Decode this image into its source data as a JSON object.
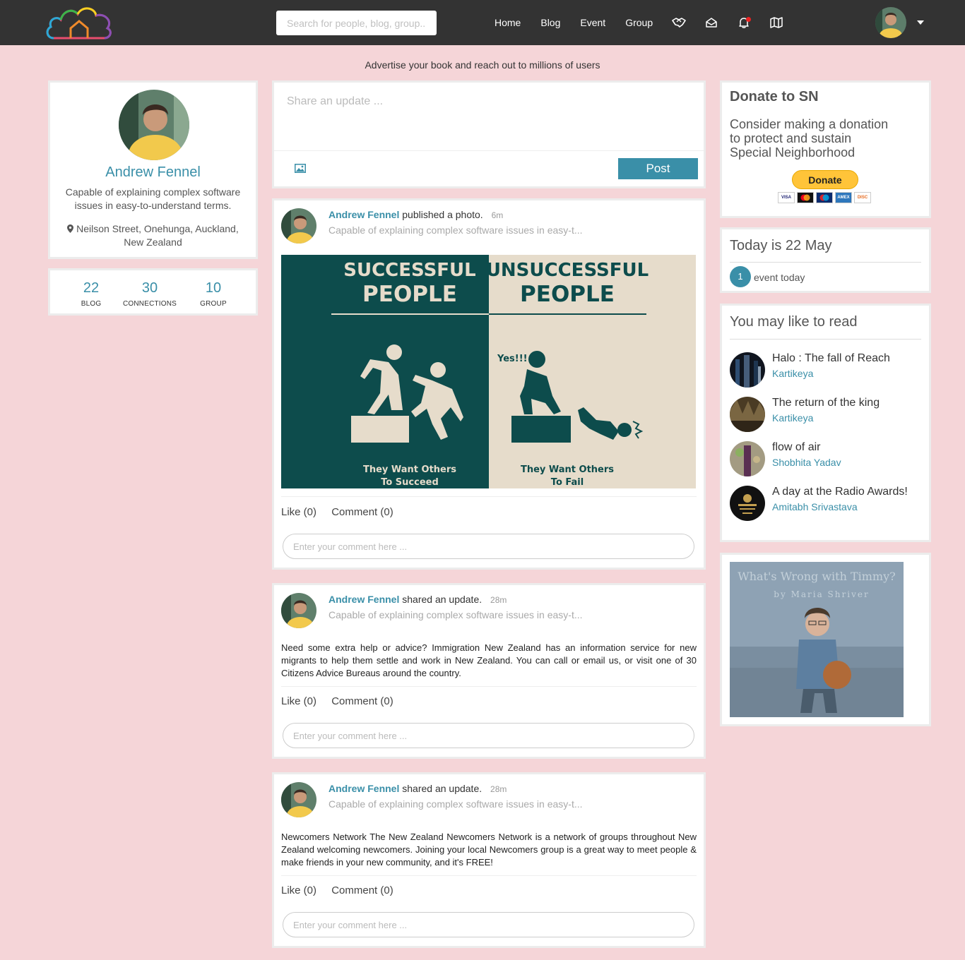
{
  "nav": {
    "search_placeholder": "Search for people, blog, group..",
    "links": [
      "Home",
      "Blog",
      "Event",
      "Group"
    ]
  },
  "ad": {
    "text": "Advertise your book and reach out to millions of users"
  },
  "profile": {
    "name": "Andrew Fennel",
    "bio": "Capable of explaining complex software issues in easy-to-understand terms.",
    "location": "Neilson Street, Onehunga, Auckland, New Zealand",
    "stats": [
      {
        "value": "22",
        "label": "BLOG"
      },
      {
        "value": "30",
        "label": "CONNECTIONS"
      },
      {
        "value": "10",
        "label": "GROUP"
      }
    ]
  },
  "share": {
    "placeholder": "Share an update ...",
    "post_label": "Post"
  },
  "posts": [
    {
      "author": "Andrew Fennel",
      "action": "published a photo.",
      "time": "6m",
      "subtitle": "Capable of explaining complex software issues in easy-t...",
      "image": {
        "left_title_1": "SUCCESSFUL",
        "left_title_2": "PEOPLE",
        "right_title_1": "UNSUCCESSFUL",
        "right_title_2": "PEOPLE",
        "yes": "Yes!!!",
        "left_caption_1": "They Want Others",
        "left_caption_2": "To Succeed",
        "right_caption_1": "They Want Others",
        "right_caption_2": "To Fail"
      },
      "like": "Like (0)",
      "comment": "Comment (0)",
      "comment_placeholder": "Enter your comment here ..."
    },
    {
      "author": "Andrew Fennel",
      "action": "shared an update.",
      "time": "28m",
      "subtitle": "Capable of explaining complex software issues in easy-t...",
      "text": "Need some extra help or advice? Immigration New Zealand has an information service for new migrants to help them settle and work in New Zealand. You can call or email us, or visit one of 30 Citizens Advice Bureaus around the country.",
      "like": "Like (0)",
      "comment": "Comment (0)",
      "comment_placeholder": "Enter your comment here ..."
    },
    {
      "author": "Andrew Fennel",
      "action": "shared an update.",
      "time": "28m",
      "subtitle": "Capable of explaining complex software issues in easy-t...",
      "text": "Newcomers Network The New Zealand Newcomers Network is a network of groups throughout New Zealand welcoming newcomers. Joining your local Newcomers group is a great way to meet people & make friends in your new community, and it's FREE!",
      "like": "Like (0)",
      "comment": "Comment (0)",
      "comment_placeholder": "Enter your comment here ..."
    }
  ],
  "donate": {
    "title": "Donate to SN",
    "text_1": "Consider making a donation",
    "text_2": "to protect and sustain",
    "text_3": "Special Neighborhood",
    "button": "Donate"
  },
  "today": {
    "title": "Today is 22 May",
    "count": "1",
    "label": "event today"
  },
  "reads": {
    "title": "You may like to read",
    "items": [
      {
        "title": "Halo : The fall of Reach",
        "author": "Kartikeya"
      },
      {
        "title": "The return of the king",
        "author": "Kartikeya"
      },
      {
        "title": "flow of air",
        "author": "Shobhita Yadav"
      },
      {
        "title": "A day at the Radio Awards!",
        "author": "Amitabh Srivastava"
      }
    ]
  },
  "book_ad": {
    "title": "What's Wrong with Timmy?",
    "author": "by Maria Shriver"
  },
  "colors": {
    "accent": "#3a8fa8",
    "nav": "#333333",
    "background": "#f5d5d8",
    "poster_dark": "#0d4c4c",
    "poster_light": "#e6dccb"
  }
}
